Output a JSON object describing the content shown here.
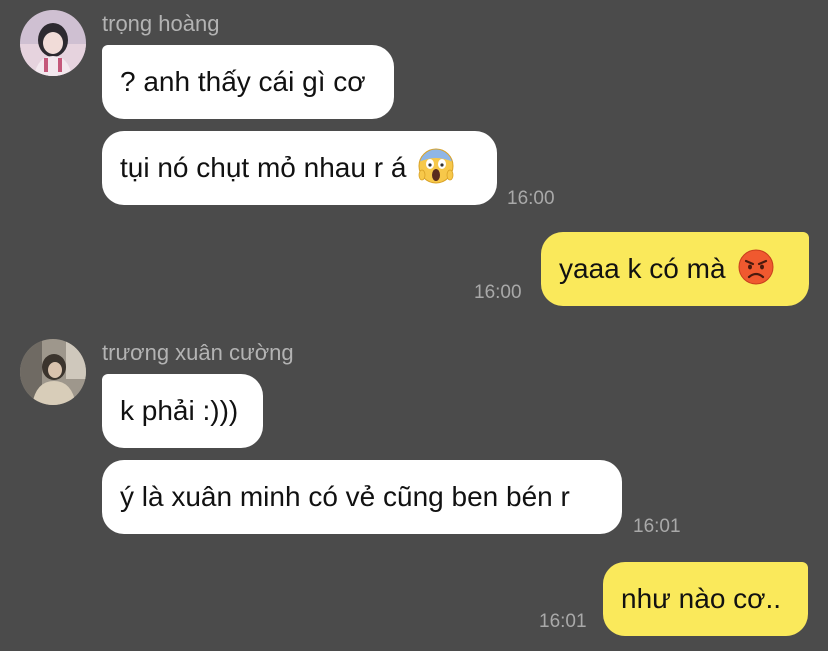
{
  "messages": [
    {
      "sender": "trọng hoàng",
      "text": "? anh thấy cái gì cơ"
    },
    {
      "text": "tụi nó chụt mỏ nhau r á",
      "emoji": "face-screaming-in-fear-emoji",
      "time": "16:00"
    },
    {
      "text": "yaaa k có mà",
      "emoji": "pouting-face-emoji",
      "time": "16:00"
    },
    {
      "sender": "trương xuân cường",
      "text": "k phải :)))"
    },
    {
      "text": "ý là xuân minh có vẻ cũng ben bén r",
      "time": "16:01"
    },
    {
      "text": "như nào cơ..",
      "time": "16:01"
    }
  ],
  "colors": {
    "background": "#4b4b4b",
    "incoming_bubble": "#ffffff",
    "outgoing_bubble": "#fae95b",
    "meta_text": "#b3b3b3"
  }
}
